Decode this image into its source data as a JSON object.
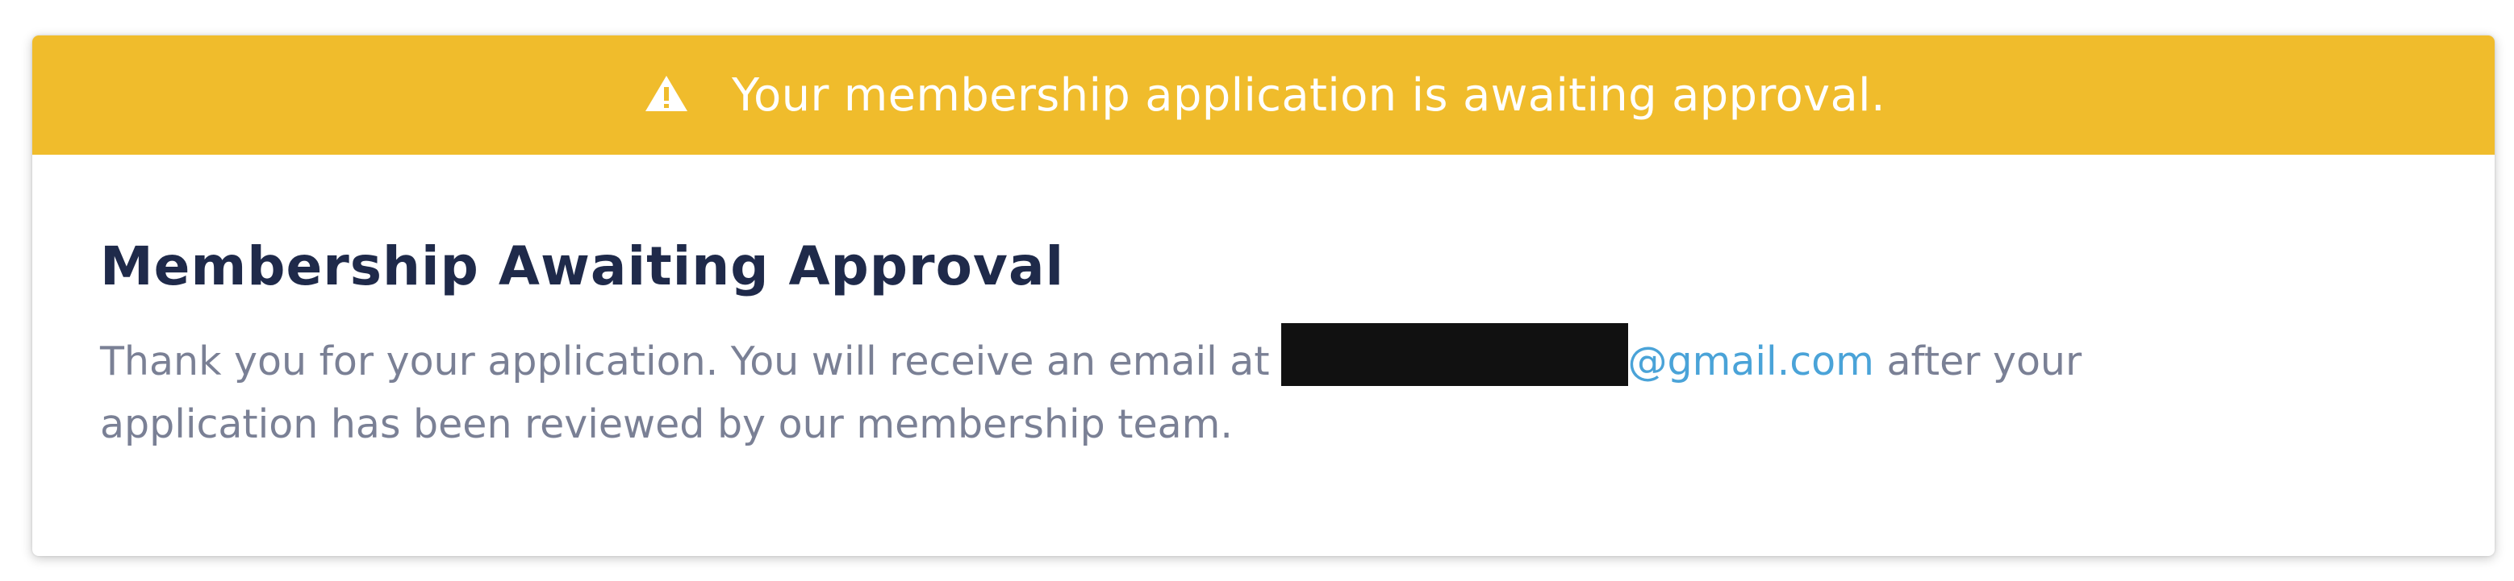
{
  "banner": {
    "icon": "warning-triangle-icon",
    "message": "Your membership application is awaiting approval.",
    "background_color": "#F0BC2C"
  },
  "notice": {
    "title": "Membership Awaiting Approval",
    "body_before": "Thank you for your application. You will receive an email at",
    "email_domain": "@gmail.com",
    "body_after": "after your application has been reviewed by our membership team."
  }
}
